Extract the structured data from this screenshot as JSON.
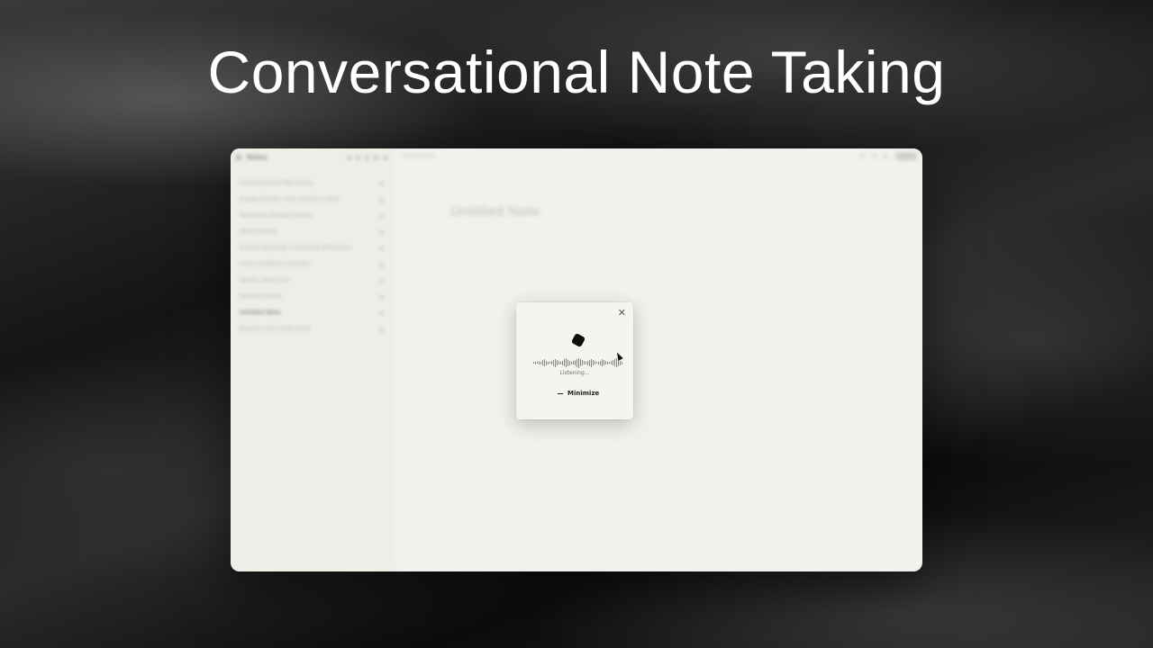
{
  "headline": "Conversational Note Taking",
  "app": {
    "name": "Notes",
    "breadcrumb": "Untitled Note",
    "note_title": "Untitled Note"
  },
  "sidebar": {
    "notes": [
      {
        "label": "Understanding Web Privacy",
        "active": false
      },
      {
        "label": "Design Process: From Sketch to Final",
        "active": false
      },
      {
        "label": "Marketing Strategy Review",
        "active": false
      },
      {
        "label": "Ideas Backlog",
        "active": false
      },
      {
        "label": "Product Roadmap & Quarterly Milestones",
        "active": false
      },
      {
        "label": "Client Feedback Summary",
        "active": false
      },
      {
        "label": "Weekly Team Sync",
        "active": false
      },
      {
        "label": "Research Notes",
        "active": false
      },
      {
        "label": "Untitled Note",
        "active": true
      },
      {
        "label": "Reading List & Book Notes",
        "active": false
      }
    ]
  },
  "modal": {
    "status": "Listening...",
    "minimize_label": "Minimize",
    "close_icon": "close-icon",
    "orb_icon": "voice-orb-icon"
  },
  "colors": {
    "window_bg": "#f2f2ec",
    "accent": "#0d0d0d"
  }
}
